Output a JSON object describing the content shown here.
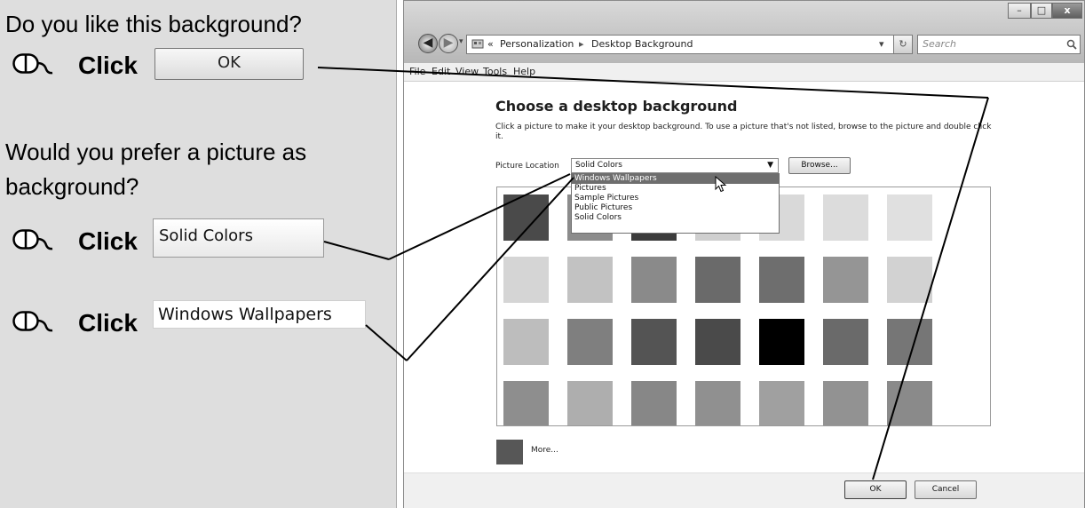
{
  "instructions": {
    "q1": "Do you like this background?",
    "click_word": "Click",
    "ok_ref": "OK",
    "q2_line1": "Would you prefer a picture as",
    "q2_line2": "background?",
    "solid_ref": "Solid Colors",
    "wallpapers_ref": "Windows Wallpapers"
  },
  "window": {
    "controls": {
      "minimize": "–",
      "maximize": "□",
      "close": "x"
    },
    "back_icon": "back-arrow-icon",
    "forward_icon": "forward-arrow-icon",
    "breadcrumb_prefix": "«",
    "breadcrumbs": [
      "Personalization",
      "Desktop Background"
    ],
    "breadcrumb_separator": "▸",
    "address_dropdown": "▾",
    "refresh": "↻",
    "search_placeholder": "Search",
    "menu": [
      "File",
      "Edit",
      "View",
      "Tools",
      "Help"
    ],
    "title": "Choose a desktop background",
    "description": "Click a picture to make it your desktop background. To use a picture that's not listed, browse to the picture and double click it.",
    "picture_location_label": "Picture Location",
    "picture_location_value": "Solid Colors",
    "browse_button": "Browse...",
    "dropdown_options": [
      {
        "label": "Windows Wallpapers",
        "selected": true
      },
      {
        "label": "Pictures",
        "selected": false
      },
      {
        "label": "Sample Pictures",
        "selected": false
      },
      {
        "label": "Public Pictures",
        "selected": false
      },
      {
        "label": "Solid Colors",
        "selected": false
      }
    ],
    "swatch_rows": [
      [
        "#4a4a4a",
        "#8c8c8c",
        "#3c3c3c",
        "#cfcfcf",
        "#d9d9d9",
        "#dcdcdc",
        "#e0e0e0"
      ],
      [
        "#d5d5d5",
        "#c2c2c2",
        "#8a8a8a",
        "#6a6a6a",
        "#6e6e6e",
        "#959595",
        "#d2d2d2"
      ],
      [
        "#bdbdbd",
        "#7f7f7f",
        "#545454",
        "#4a4a4a",
        "#000000",
        "#6a6a6a",
        "#767676"
      ],
      [
        "#8e8e8e",
        "#aeaeae",
        "#878787",
        "#909090",
        "#a0a0a0",
        "#929292",
        "#8a8a8a"
      ]
    ],
    "more_label": "More...",
    "ok_button": "OK",
    "cancel_button": "Cancel"
  }
}
